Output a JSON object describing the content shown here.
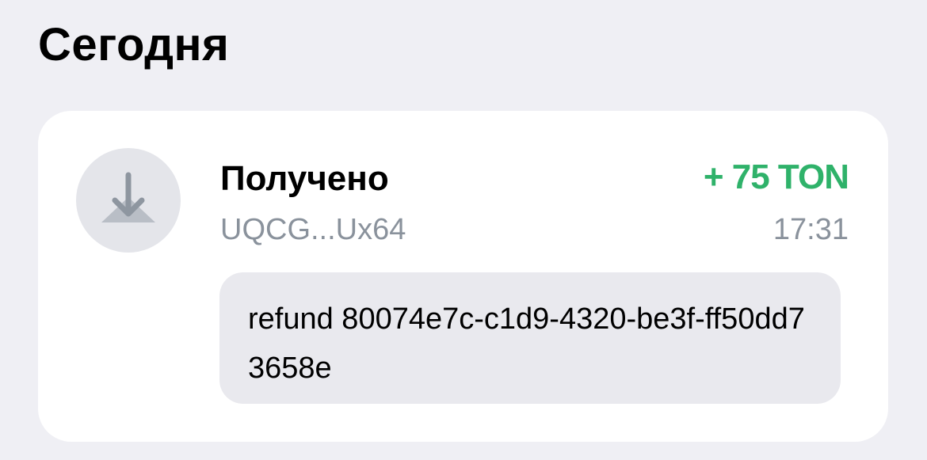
{
  "section": {
    "title": "Сегодня"
  },
  "transaction": {
    "icon": "download-arrow-icon",
    "title": "Получено",
    "address": "UQCG...Ux64",
    "amount": "+ 75 TON",
    "time": "17:31",
    "comment": "refund 80074e7c-c1d9-4320-be3f-ff50dd73658e",
    "colors": {
      "amount": "#2fb26a",
      "secondary_text": "#8a929c",
      "icon": "#8e96a0"
    }
  }
}
